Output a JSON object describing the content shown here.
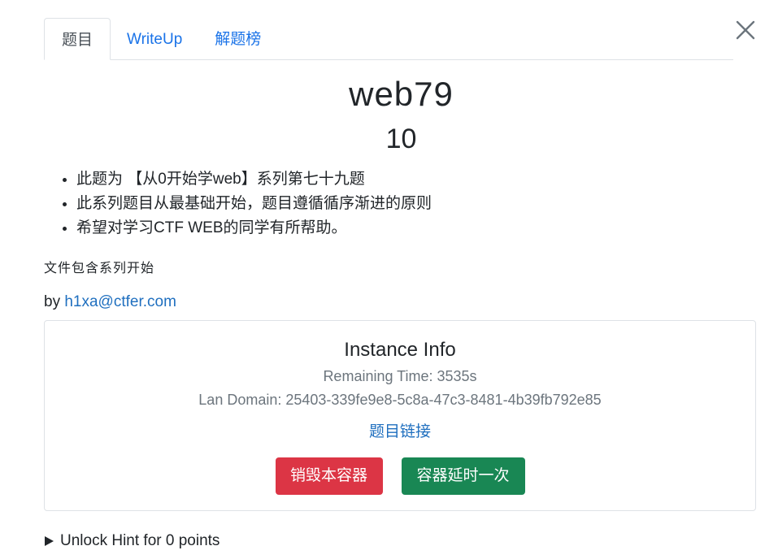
{
  "tabs": [
    {
      "label": "题目",
      "active": true
    },
    {
      "label": "WriteUp",
      "active": false
    },
    {
      "label": "解题榜",
      "active": false
    }
  ],
  "challenge": {
    "name": "web79",
    "value": "10",
    "description_items": [
      "此题为 【从0开始学web】系列第七十九题",
      "此系列题目从最基础开始，题目遵循循序渐进的原则",
      "希望对学习CTF WEB的同学有所帮助。"
    ],
    "subdescription": "文件包含系列开始",
    "author_prefix": "by ",
    "author_link": "h1xa@ctfer.com"
  },
  "instance": {
    "title": "Instance Info",
    "remaining_time": "Remaining Time: 3535s",
    "lan_domain": "Lan Domain: 25403-339fe9e8-5c8a-47c3-8481-4b39fb792e85",
    "link_label": "题目链接",
    "destroy_label": "销毁本容器",
    "extend_label": "容器延时一次"
  },
  "hint": {
    "label": "Unlock Hint for 0 points"
  },
  "colors": {
    "link": "#1a73e8",
    "danger": "#dc3545",
    "success": "#198754",
    "muted": "#6c757d"
  },
  "icons": {
    "close": "close-icon",
    "hint_toggle": "triangle-right-icon"
  }
}
